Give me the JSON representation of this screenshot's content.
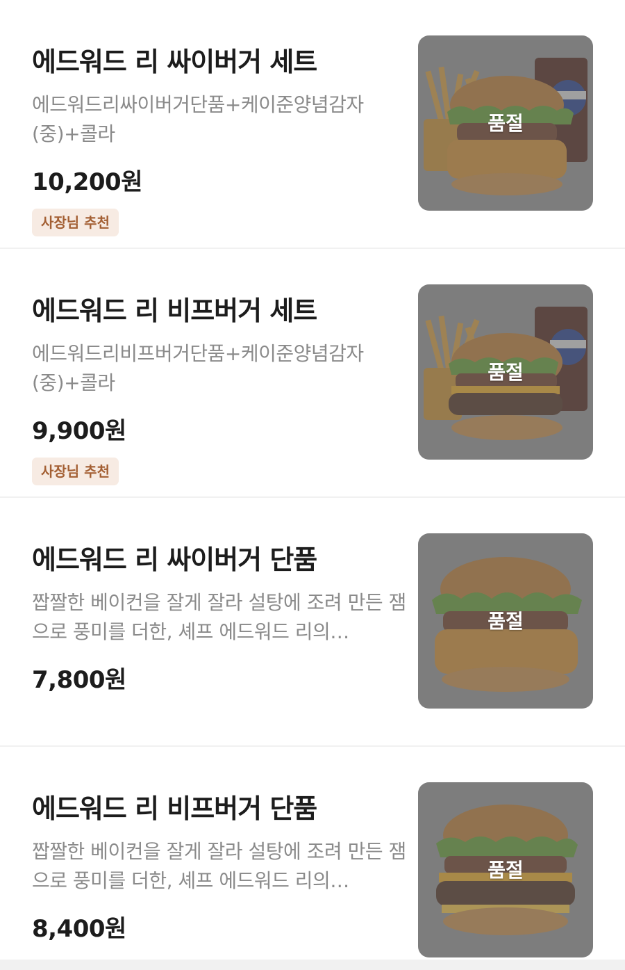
{
  "menu": {
    "items": [
      {
        "name": "에드워드 리 싸이버거 세트",
        "description": "에드워드리싸이버거단품+케이준양념감자(중)+콜라",
        "price": "10,200원",
        "badge": "사장님 추천",
        "status": "품절",
        "image_icon": "chicken-burger-set-image"
      },
      {
        "name": "에드워드 리 비프버거 세트",
        "description": "에드워드리비프버거단품+케이준양념감자(중)+콜라",
        "price": "9,900원",
        "badge": "사장님 추천",
        "status": "품절",
        "image_icon": "beef-burger-set-image"
      },
      {
        "name": "에드워드 리 싸이버거 단품",
        "description": "짭짤한 베이컨을 잘게 잘라 설탕에 조려 만든 잼으로 풍미를 더한, 셰프 에드워드 리의…",
        "price": "7,800원",
        "status": "품절",
        "image_icon": "chicken-burger-image"
      },
      {
        "name": "에드워드 리 비프버거 단품",
        "description": "짭짤한 베이컨을 잘게 잘라 설탕에 조려 만든 잼으로 풍미를 더한, 셰프 에드워드 리의…",
        "price": "8,400원",
        "status": "품절",
        "image_icon": "beef-burger-image"
      }
    ]
  },
  "colors": {
    "badge_bg": "#f7ebe3",
    "badge_text": "#a35f33",
    "desc_text": "#8a8a8a",
    "divider": "#f1f1f1"
  }
}
